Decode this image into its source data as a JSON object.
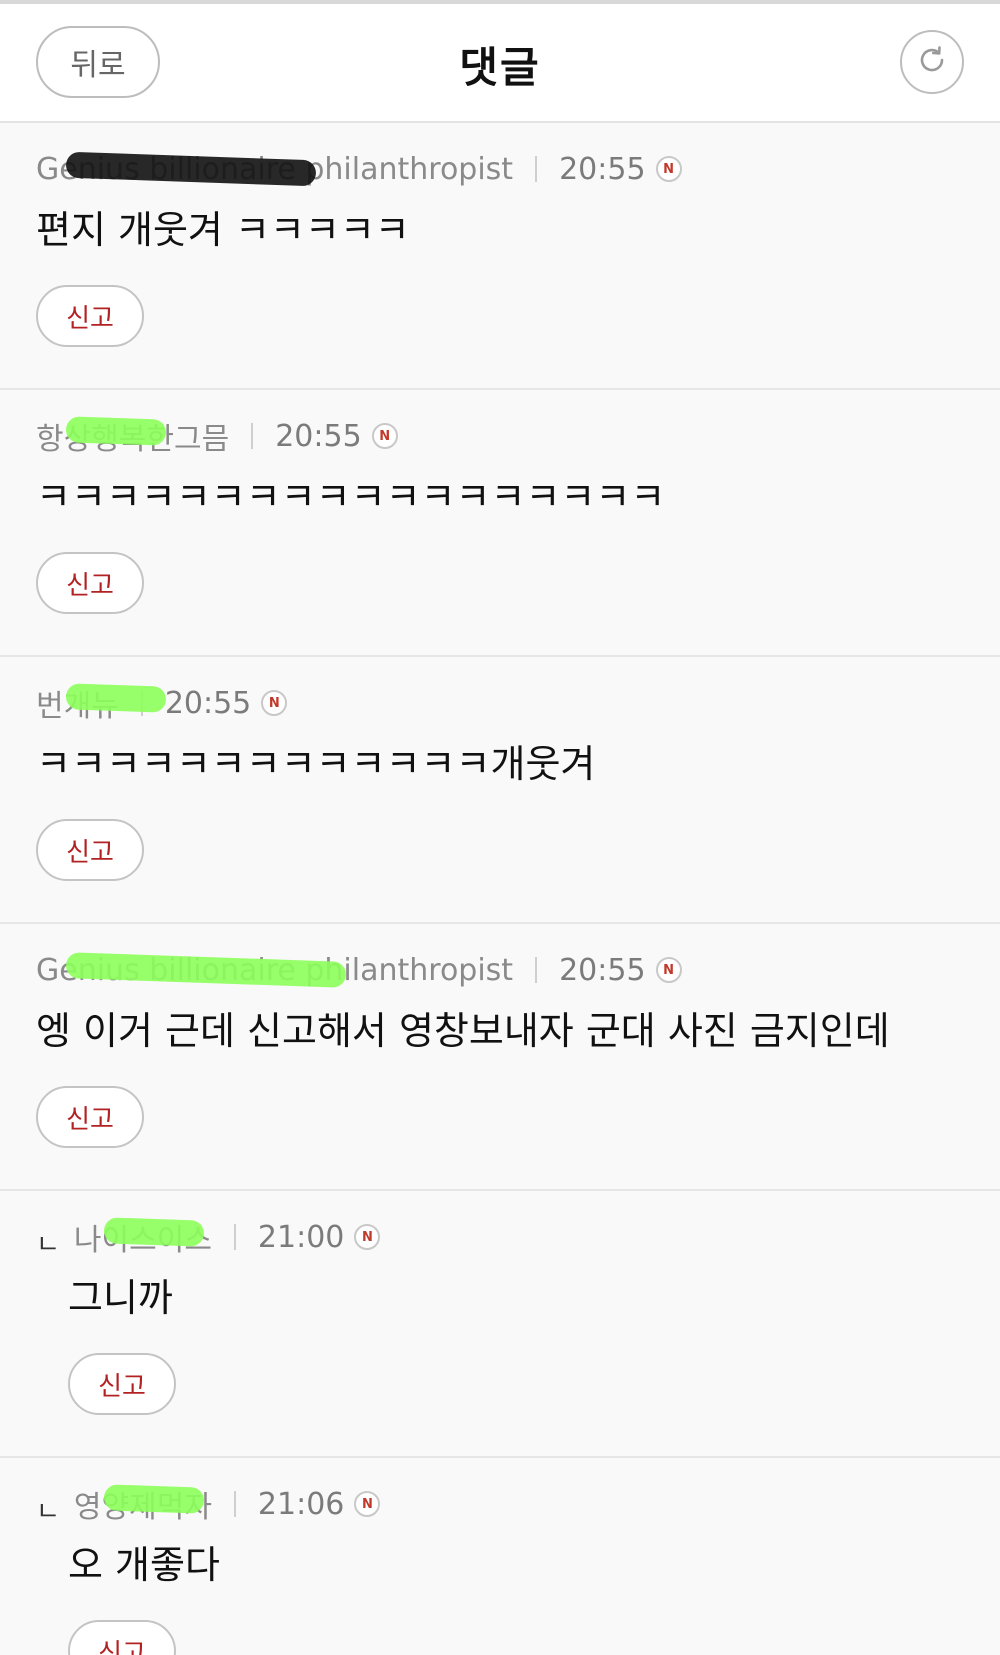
{
  "header": {
    "back_label": "뒤로",
    "title": "댓글",
    "refresh_icon": "refresh-icon"
  },
  "badge_label": "N",
  "reply_marker": "ㄴ",
  "comments": [
    {
      "author": "Genius billionaire philanthropist",
      "time": "20:55",
      "text": "편지 개웃겨 ㅋㅋㅋㅋㅋ",
      "report_label": "신고",
      "is_reply": false,
      "redaction_color": "#111111"
    },
    {
      "author": "항상행복한그믐",
      "time": "20:55",
      "text": "ㅋㅋㅋㅋㅋㅋㅋㅋㅋㅋㅋㅋㅋㅋㅋㅋㅋㅋ",
      "report_label": "신고",
      "is_reply": false,
      "redaction_color": "#8cff5a"
    },
    {
      "author": "번개뉴",
      "time": "20:55",
      "text": "ㅋㅋㅋㅋㅋㅋㅋㅋㅋㅋㅋㅋㅋ개웃겨",
      "report_label": "신고",
      "is_reply": false,
      "redaction_color": "#8cff5a"
    },
    {
      "author": "Genius billionaire philanthropist",
      "time": "20:55",
      "text": "엥 이거 근데 신고해서 영창보내자 군대 사진 금지인데",
      "report_label": "신고",
      "is_reply": false,
      "redaction_color": "#8cff5a"
    },
    {
      "author": "나이스이스",
      "time": "21:00",
      "text": "그니까",
      "report_label": "신고",
      "is_reply": true,
      "redaction_color": "#8cff5a"
    },
    {
      "author": "영양제먹자",
      "time": "21:06",
      "text": "오 개좋다",
      "report_label": "신고",
      "is_reply": true,
      "redaction_color": "#8cff5a"
    }
  ]
}
